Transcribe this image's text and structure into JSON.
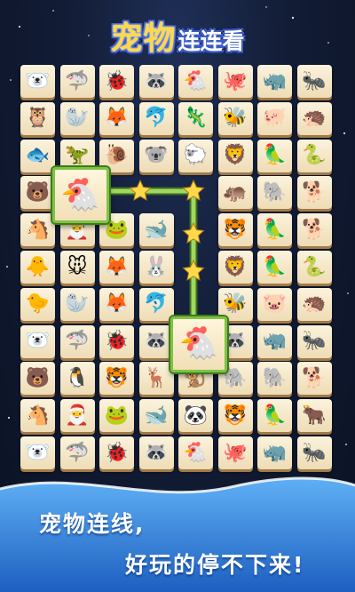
{
  "title": {
    "main": "宠物",
    "sub": "连连看"
  },
  "caption": {
    "line1": "宠物连线,",
    "line2": "好玩的停不下来!"
  },
  "colors": {
    "accent": "#7fc245",
    "title": "#ffd84a",
    "path": "#ffd94a",
    "wave": "#2f78d6"
  },
  "board": {
    "rows": 11,
    "cols": 9,
    "grid": [
      [
        "🐻‍❄️",
        "🦈",
        "🐞",
        "🦝",
        "🐔",
        "🐙",
        "🦏",
        "🐜",
        ""
      ],
      [
        "🦉",
        "🦭",
        "🦊",
        "🐬",
        "🦎",
        "🐝",
        "🐖",
        "🦔",
        ""
      ],
      [
        "🐟",
        "🦖",
        "🐌",
        "🐨",
        "🐑",
        "🦁",
        "🦜",
        "🐍",
        ""
      ],
      [
        "🐻",
        "🐔",
        "",
        "",
        "",
        "🦛",
        "🐘",
        "🐕",
        ""
      ],
      [
        "🐴",
        "🎅",
        "🐸",
        "🐋",
        "",
        "🐯",
        "🦜",
        "🐕",
        ""
      ],
      [
        "🐥",
        "🐭",
        "🦊",
        "🐰",
        "",
        "🦁",
        "🦜",
        "🐍",
        ""
      ],
      [
        "🐤",
        "🦭",
        "🦊",
        "🐬",
        "",
        "🐝",
        "🐷",
        "🦔",
        ""
      ],
      [
        "🐻‍❄️",
        "🦈",
        "🐞",
        "🦝",
        "🐔",
        "🦝",
        "🦏",
        "🐜",
        ""
      ],
      [
        "🐻",
        "🐧",
        "🐯",
        "🦌",
        "🐒",
        "🐘",
        "🐘",
        "🐕",
        ""
      ],
      [
        "🐴",
        "🎅",
        "🐸",
        "🐋",
        "🐼",
        "🐯",
        "🦜",
        "🐂",
        ""
      ],
      [
        "🐻‍❄️",
        "🦈",
        "🐞",
        "🦝",
        "🐔",
        "🐙",
        "🦏",
        "🐜",
        ""
      ]
    ],
    "selected": [
      [
        3,
        1
      ],
      [
        7,
        4
      ]
    ]
  }
}
